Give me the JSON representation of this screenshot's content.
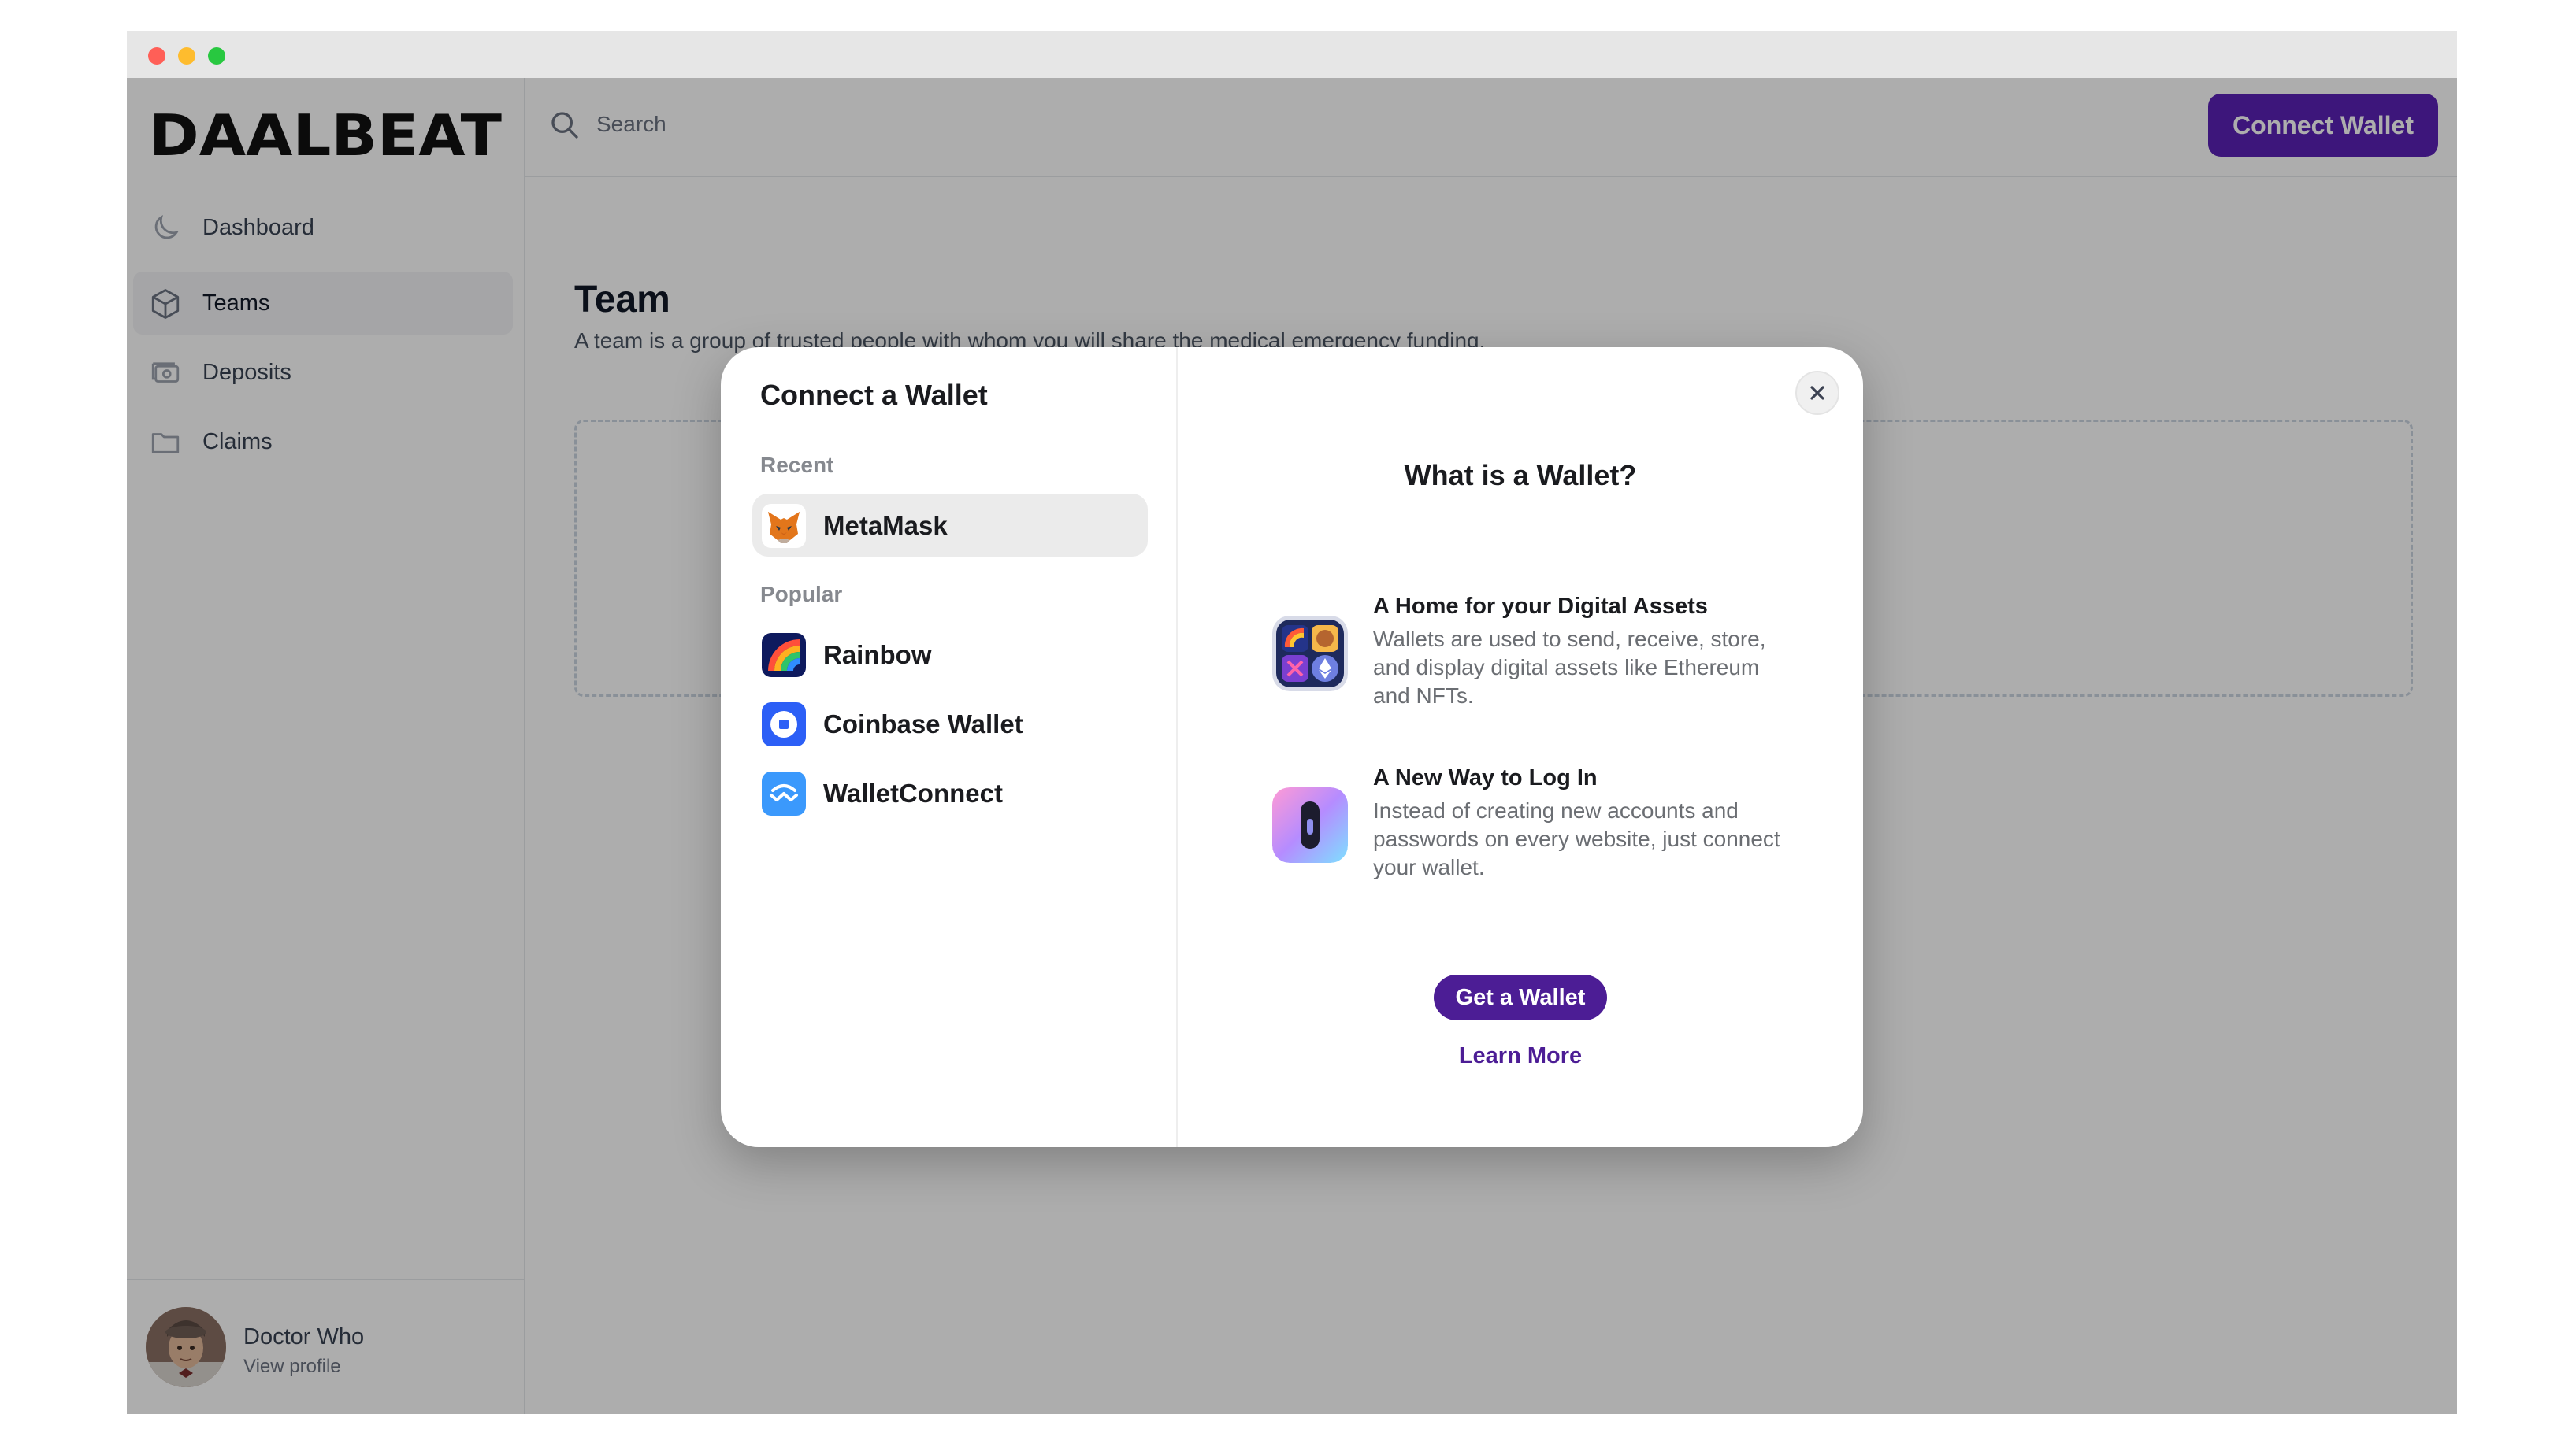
{
  "app": {
    "brand": "DAALBEAT",
    "sidebar": {
      "items": [
        {
          "label": "Dashboard",
          "icon": "moon-icon"
        },
        {
          "label": "Teams",
          "icon": "cube-icon",
          "active": true
        },
        {
          "label": "Deposits",
          "icon": "cash-icon"
        },
        {
          "label": "Claims",
          "icon": "folder-icon"
        }
      ]
    },
    "profile": {
      "name": "Doctor Who",
      "link": "View profile"
    },
    "topbar": {
      "search_placeholder": "Search",
      "connect_label": "Connect Wallet"
    },
    "main": {
      "title": "Team",
      "subtitle": "A team is a group of trusted people with whom you will share the medical emergency funding."
    }
  },
  "modal": {
    "title": "Connect a Wallet",
    "recent_label": "Recent",
    "popular_label": "Popular",
    "recent": [
      {
        "label": "MetaMask",
        "icon": "metamask-icon"
      }
    ],
    "popular": [
      {
        "label": "Rainbow",
        "icon": "rainbow-icon"
      },
      {
        "label": "Coinbase Wallet",
        "icon": "coinbase-icon"
      },
      {
        "label": "WalletConnect",
        "icon": "walletconnect-icon"
      }
    ],
    "info": {
      "title": "What is a Wallet?",
      "features": [
        {
          "title": "A Home for your Digital Assets",
          "desc": "Wallets are used to send, receive, store, and display digital assets like Ethereum and NFTs."
        },
        {
          "title": "A New Way to Log In",
          "desc": "Instead of creating new accounts and passwords on every website, just connect your wallet."
        }
      ],
      "get_wallet_label": "Get a Wallet",
      "learn_more_label": "Learn More"
    }
  },
  "colors": {
    "primary": "#5b21b6",
    "primary_dark": "#4c1d95"
  }
}
